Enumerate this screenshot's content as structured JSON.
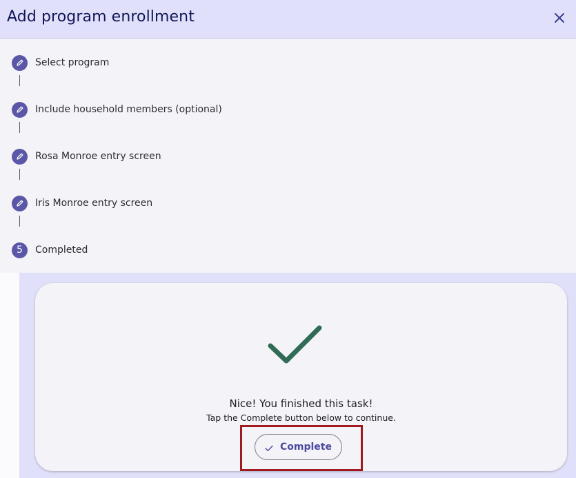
{
  "dialog": {
    "title": "Add program enrollment",
    "close_icon": "close-icon"
  },
  "steps": [
    {
      "label": "Select program",
      "icon": "pencil-icon",
      "status": "done"
    },
    {
      "label": "Include household members (optional)",
      "icon": "pencil-icon",
      "status": "done"
    },
    {
      "label": "Rosa Monroe entry screen",
      "icon": "pencil-icon",
      "status": "done"
    },
    {
      "label": "Iris Monroe entry screen",
      "icon": "pencil-icon",
      "status": "done"
    },
    {
      "label": "Completed",
      "number": "5",
      "status": "current"
    }
  ],
  "completion": {
    "title": "Nice! You finished this task!",
    "subtitle": "Tap the Complete button below to continue.",
    "button_label": "Complete",
    "button_icon": "check-icon"
  },
  "colors": {
    "header_bg": "#e1e0fa",
    "title_color": "#121657",
    "step_icon_bg": "#5b57a8",
    "check_color": "#2f6b55",
    "button_text": "#4b4aa0",
    "highlight": "#a01a1f"
  }
}
